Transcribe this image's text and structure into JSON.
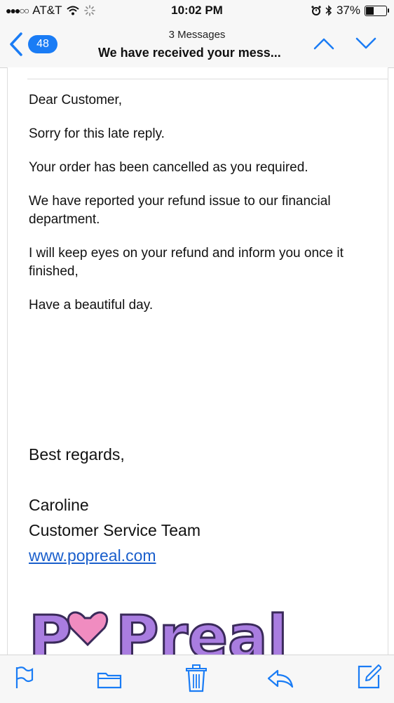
{
  "status_bar": {
    "signal": "●●●○○",
    "carrier": "AT&T",
    "time": "10:02 PM",
    "battery": "37%",
    "battery_level": 0.37
  },
  "nav": {
    "back_count": "48",
    "subtitle": "3 Messages",
    "title": "We have received your mess..."
  },
  "message": {
    "greeting": "Dear Customer,",
    "paragraphs": [
      "Sorry for this late reply.",
      "Your order  has been cancelled as you required.",
      "We have reported your refund issue to our financial department.",
      "I will keep eyes on your refund and inform you once it finished,",
      "Have a beautiful day."
    ],
    "signature": {
      "regards": "Best regards,",
      "name": "Caroline",
      "team": "Customer Service Team",
      "link": "www.popreal.com"
    },
    "logo_text": "PoPreal"
  },
  "colors": {
    "accent": "#1a7cf5",
    "link": "#1a5fcc",
    "logo": "#a97de0",
    "heart": "#f08cc0"
  },
  "icons": {
    "back": "chevron-left-icon",
    "up": "chevron-up-icon",
    "down": "chevron-down-icon",
    "flag": "flag-icon",
    "folder": "folder-icon",
    "trash": "trash-icon",
    "reply": "reply-icon",
    "compose": "compose-icon",
    "wifi": "wifi-icon",
    "alarm": "alarm-icon",
    "bluetooth": "bluetooth-icon"
  }
}
